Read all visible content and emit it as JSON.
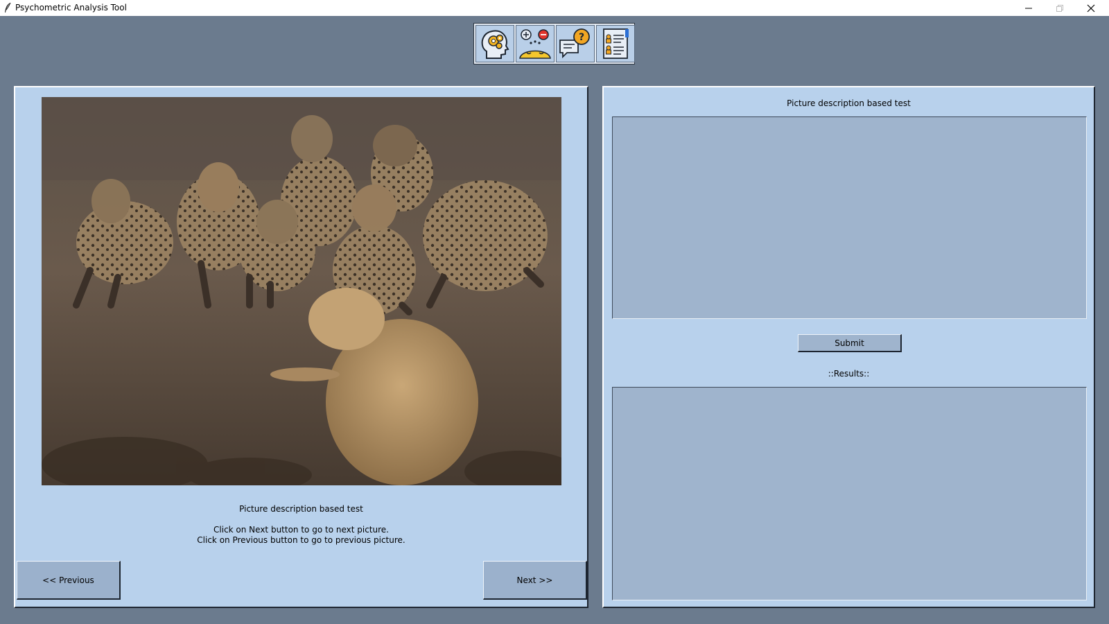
{
  "window": {
    "title": "Psychometric Analysis Tool"
  },
  "toolbar": {
    "buttons": [
      {
        "icon": "head-gears-icon"
      },
      {
        "icon": "plus-minus-emotions-icon"
      },
      {
        "icon": "chat-question-icon"
      },
      {
        "icon": "profile-document-icon"
      }
    ]
  },
  "left_panel": {
    "caption": "Picture description based test",
    "instruction_line1": "Click on Next button to go to next picture.",
    "instruction_line2": "Click on Previous button to go to previous picture.",
    "previous_label": "<< Previous",
    "next_label": "Next >>"
  },
  "right_panel": {
    "heading": "Picture description based test",
    "description_value": "",
    "submit_label": "Submit",
    "results_label": "::Results::",
    "results_value": ""
  },
  "colors": {
    "background": "#6b7b8e",
    "panel": "#b8d1ec",
    "textbox": "#9fb4cd",
    "button": "#9bb1cc"
  }
}
